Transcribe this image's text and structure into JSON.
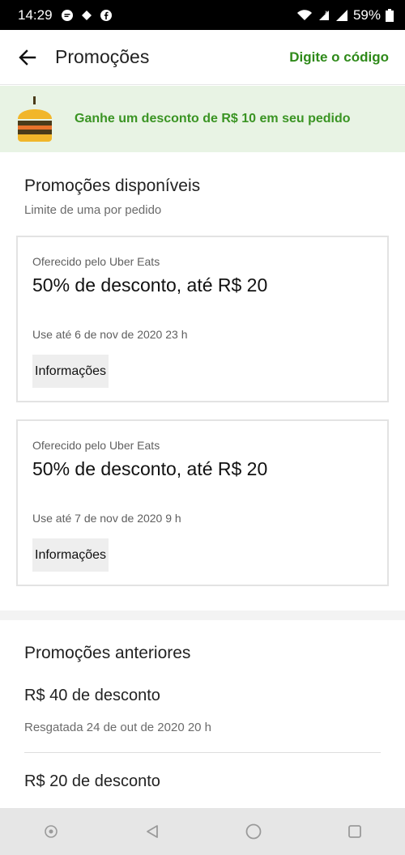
{
  "status_bar": {
    "time": "14:29",
    "battery": "59%"
  },
  "appbar": {
    "title": "Promoções",
    "action_link": "Digite o código"
  },
  "banner": {
    "text": "Ganhe um desconto de R$ 10 em seu pedido"
  },
  "available": {
    "title": "Promoções disponíveis",
    "subtitle": "Limite de uma por pedido",
    "cards": [
      {
        "offered_by": "Oferecido pelo Uber Eats",
        "headline": "50% de desconto, até R$ 20",
        "expiry": "Use até 6 de nov de 2020 23 h",
        "info_label": "Informações"
      },
      {
        "offered_by": "Oferecido pelo Uber Eats",
        "headline": "50% de desconto, até R$ 20",
        "expiry": "Use até 7 de nov de 2020 9 h",
        "info_label": "Informações"
      }
    ]
  },
  "previous": {
    "title": "Promoções anteriores",
    "items": [
      {
        "title": "R$ 40 de desconto",
        "subtitle": "Resgatada 24 de out de 2020 20 h"
      },
      {
        "title": "R$ 20 de desconto"
      }
    ]
  },
  "colors": {
    "accent_green": "#2f8a1a",
    "banner_bg": "#e8f3e4"
  }
}
